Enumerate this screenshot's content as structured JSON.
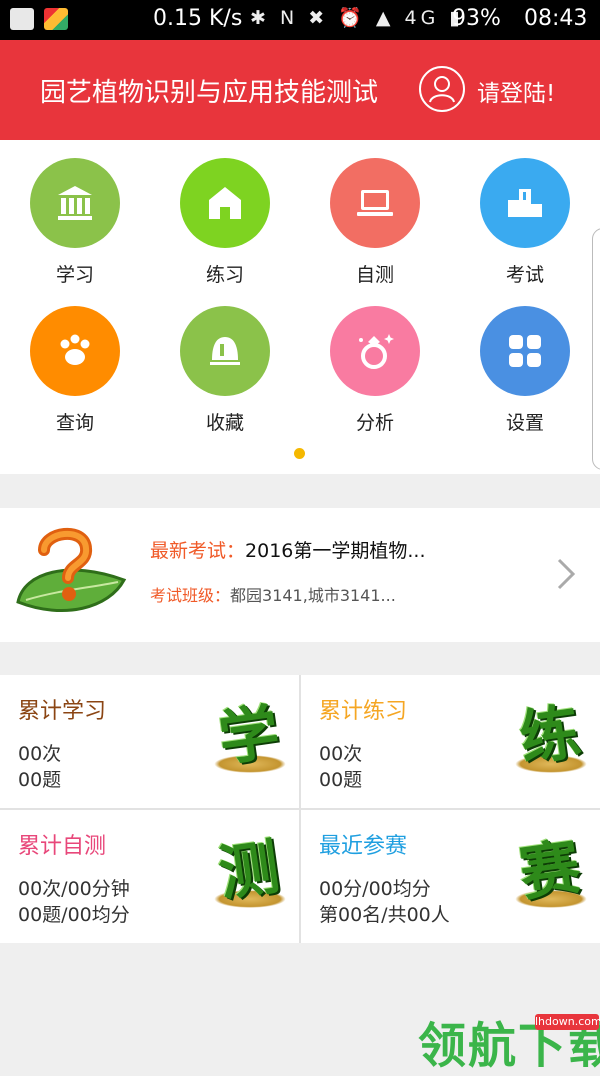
{
  "status_bar": {
    "net_speed": "0.15 K/s",
    "indicators": "✱ N ✖ ⏰ ▲ 4G ▮",
    "battery": "93%",
    "time": "08:43"
  },
  "header": {
    "title": "园艺植物识别与应用技能测试",
    "login": "请登陆!"
  },
  "menu": [
    {
      "label": "学习",
      "color": "#8bc24a",
      "icon": "bank-icon"
    },
    {
      "label": "练习",
      "color": "#7ed321",
      "icon": "home-icon"
    },
    {
      "label": "自测",
      "color": "#f26e63",
      "icon": "laptop-icon"
    },
    {
      "label": "考试",
      "color": "#3aaaf0",
      "icon": "podium-icon"
    },
    {
      "label": "查询",
      "color": "#ff8c00",
      "icon": "paw-icon"
    },
    {
      "label": "收藏",
      "color": "#8bc24a",
      "icon": "bell-icon"
    },
    {
      "label": "分析",
      "color": "#f97ba1",
      "icon": "ring-icon"
    },
    {
      "label": "设置",
      "color": "#4a90e2",
      "icon": "grid-icon"
    }
  ],
  "exam": {
    "latest_key": "最新考试：",
    "latest_value": "2016第一学期植物...",
    "class_key": "考试班级：",
    "class_value": "都园3141,城市3141..."
  },
  "stats": [
    {
      "title": "累计学习",
      "color": "#8b4513",
      "line1": "00次",
      "line2": "00题",
      "char": "学"
    },
    {
      "title": "累计练习",
      "color": "#f5a623",
      "line1": "00次",
      "line2": "00题",
      "char": "练"
    },
    {
      "title": "累计自测",
      "color": "#e8477a",
      "line1": "00次/00分钟",
      "line2": "00题/00均分",
      "char": "测"
    },
    {
      "title": "最近参赛",
      "color": "#1f9fe0",
      "line1": "00分/00均分",
      "line2": "第00名/共00人",
      "char": "赛"
    }
  ],
  "watermark": {
    "url": "lhdown.com",
    "text": "领航下载"
  }
}
